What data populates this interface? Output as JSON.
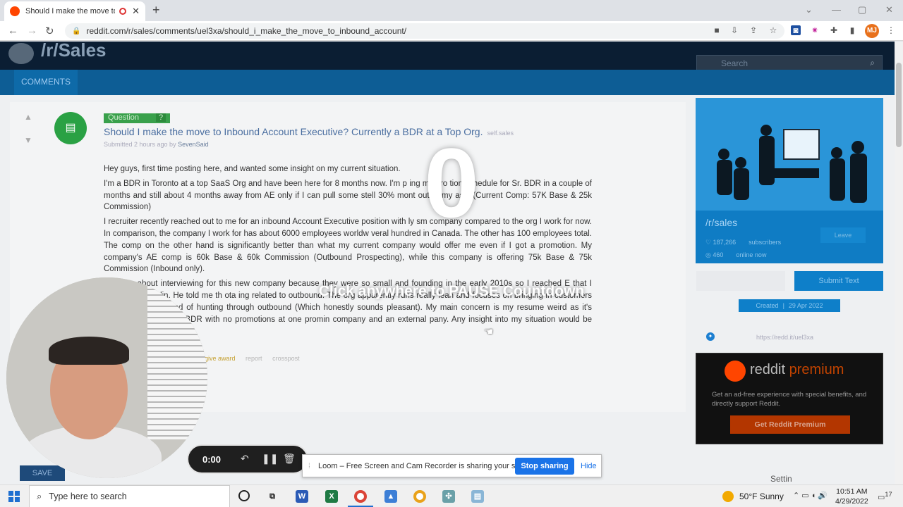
{
  "browser": {
    "tab_title": "Should I make the move to Inbound",
    "url": "reddit.com/r/sales/comments/uel3xa/should_i_make_the_move_to_inbound_account/",
    "profile_initials": "MJ"
  },
  "subreddit_header": {
    "name": "/r/Sales",
    "search_placeholder": "Search",
    "tab": "COMMENTS"
  },
  "post": {
    "flair": "Question",
    "flair_mark": "?",
    "title": "Should I make the move to Inbound Account Executive? Currently a BDR at a Top Org.",
    "domain": "self.sales",
    "submitted": "Submitted 2 hours ago by",
    "author": "SevenSaid",
    "paragraphs": [
      "Hey guys, first time posting here, and wanted some insight on my current situation.",
      "I'm a BDR in Toronto at a top SaaS Org and have been here for 8 months now. I'm p   ing my pro   tion schedule for Sr. BDR in a couple of months and still about 4 months away from AE only if I can pull some stell   30% mont   out of my ass. (Current Comp: 57K Base & 25k Commission)",
      "I recruiter recently reached out to me for an inbound Account Executive position with    ly sm   company compared to the org I work for now. In comparison, the company I work for has about 6000 employees worldw    veral hundred in Canada. The other has 100 employees total. The comp on the other hand is significantly better than what my current company would offer me even if I got a promotion. My company's AE comp is 60k Base & 60k Commission (Outbound Prospecting), while this company is offering 75k Base & 75k Commission (Inbound only).",
      "r unsure about interviewing for this new company because they were so small and founding in the early 2010s so I reached      E that I found on Linkedin. He told me th      ota      ing related to outbound. The org apparently runs really lean and focuses on bringing in customers that are      eting instead of hunting through outbound (Which honestly sounds pleasant). My main concern is my resume      weird as it's gonna show me as a BDR with no promotions at one promin     company and an external      pany. Any insight into my situation would be appreciated."
    ],
    "actions": [
      "give award",
      "report",
      "crosspost"
    ],
    "save": "SAVE"
  },
  "sidebar": {
    "name": "/r/sales",
    "subscribers_count": "187,266",
    "subscribers_label": "subscribers",
    "online_count": "460",
    "online_label": "online now",
    "leave": "Leave",
    "submit": "Submit Text",
    "created_label": "Created",
    "created_date": "29 Apr 2022",
    "shortlink": "https://redd.it/uel3xa",
    "premium_word_a": "reddit",
    "premium_word_b": "premium",
    "premium_desc": "Get an ad-free experience with special benefits, and directly support Reddit.",
    "premium_button": "Get Reddit Premium",
    "settings": "Settin"
  },
  "loom": {
    "countdown": "0",
    "pause_text": "Click anywhere to PAUSE Countdown",
    "timer": "0:00",
    "share_message": "Loom – Free Screen and Cam Recorder is sharing your screen.",
    "stop_sharing": "Stop sharing",
    "hide": "Hide"
  },
  "taskbar": {
    "search_placeholder": "Type here to search",
    "weather": "50°F  Sunny",
    "time": "10:51 AM",
    "date": "4/29/2022",
    "notifications": "17"
  }
}
